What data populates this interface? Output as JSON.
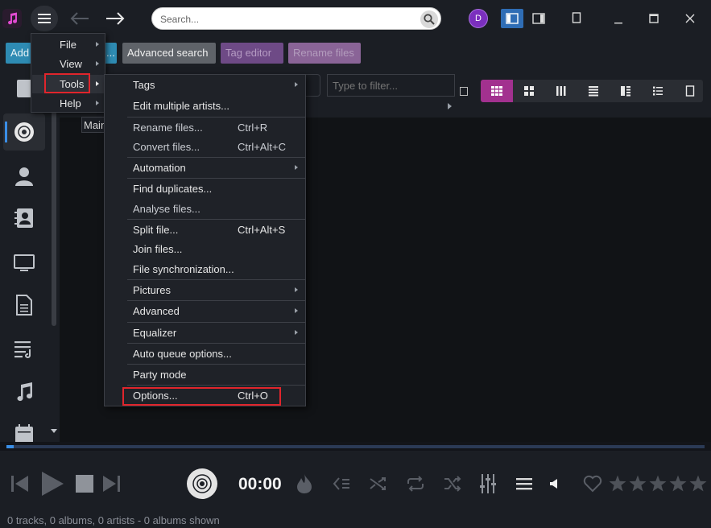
{
  "app": {
    "logo_icon": "music-note-icon"
  },
  "titlebar": {
    "search_placeholder": "Search...",
    "user_initial": "D",
    "accent": "#7b2fbe"
  },
  "toolbar": {
    "add_label": "Add",
    "more_label": "...",
    "advanced_search_label": "Advanced search",
    "tag_editor_label": "Tag editor",
    "rename_files_label": "Rename files"
  },
  "filter": {
    "placeholder": "Type to filter..."
  },
  "main_menu": {
    "items": [
      {
        "label": "File"
      },
      {
        "label": "View"
      },
      {
        "label": "Tools"
      },
      {
        "label": "Help"
      }
    ]
  },
  "tooltip": {
    "text": "Main"
  },
  "tools_menu": {
    "items": [
      {
        "label": "Tags",
        "shortcut": ""
      },
      {
        "label": "Edit multiple artists...",
        "shortcut": ""
      },
      {
        "label": "Rename files...",
        "shortcut": "Ctrl+R"
      },
      {
        "label": "Convert files...",
        "shortcut": "Ctrl+Alt+C"
      },
      {
        "label": "Automation",
        "shortcut": ""
      },
      {
        "label": "Find duplicates...",
        "shortcut": ""
      },
      {
        "label": "Analyse files...",
        "shortcut": ""
      },
      {
        "label": "Split file...",
        "shortcut": "Ctrl+Alt+S"
      },
      {
        "label": "Join files...",
        "shortcut": ""
      },
      {
        "label": "File synchronization...",
        "shortcut": ""
      },
      {
        "label": "Pictures",
        "shortcut": ""
      },
      {
        "label": "Advanced",
        "shortcut": ""
      },
      {
        "label": "Equalizer",
        "shortcut": ""
      },
      {
        "label": "Auto queue options...",
        "shortcut": ""
      },
      {
        "label": "Party mode",
        "shortcut": ""
      },
      {
        "label": "Options...",
        "shortcut": "Ctrl+O"
      }
    ]
  },
  "player": {
    "time": "00:00",
    "progress": 0.01,
    "rating_stars": 5
  },
  "status": {
    "text": "0 tracks, 0 albums, 0 artists - 0 albums shown"
  }
}
